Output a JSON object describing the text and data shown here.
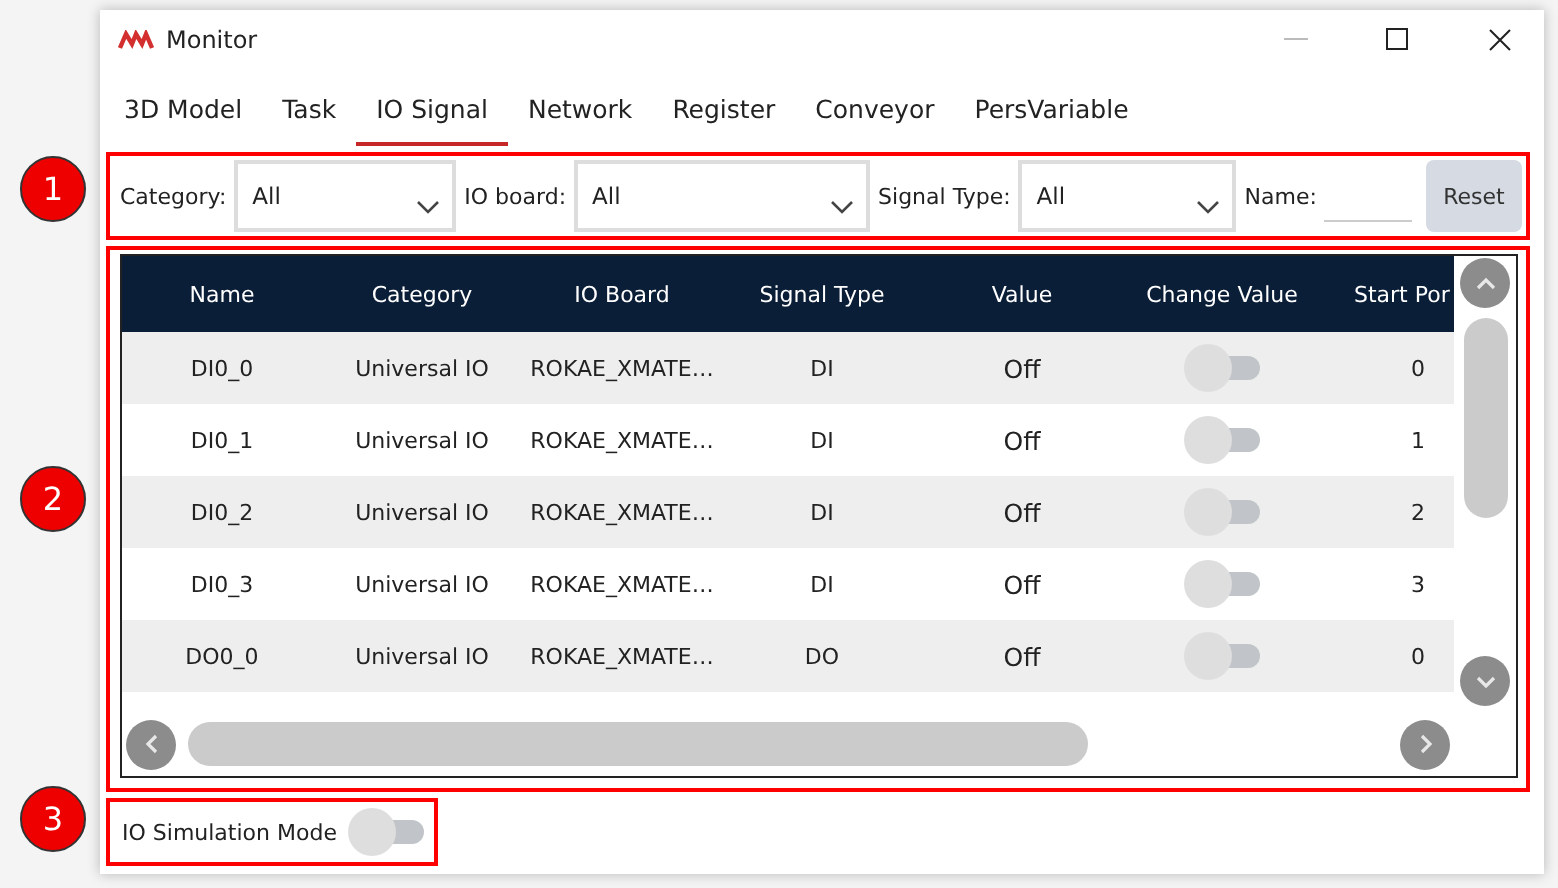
{
  "window": {
    "title": "Monitor"
  },
  "tabs": [
    {
      "label": "3D Model",
      "selected": false
    },
    {
      "label": "Task",
      "selected": false
    },
    {
      "label": "IO Signal",
      "selected": true
    },
    {
      "label": "Network",
      "selected": false
    },
    {
      "label": "Register",
      "selected": false
    },
    {
      "label": "Conveyor",
      "selected": false
    },
    {
      "label": "PersVariable",
      "selected": false
    }
  ],
  "filters": {
    "category": {
      "label": "Category:",
      "value": "All"
    },
    "io_board": {
      "label": "IO board:",
      "value": "All"
    },
    "signal_type": {
      "label": "Signal Type:",
      "value": "All"
    },
    "name": {
      "label": "Name:"
    },
    "reset_button": "Reset"
  },
  "table": {
    "columns": [
      "Name",
      "Category",
      "IO Board",
      "Signal Type",
      "Value",
      "Change Value",
      "Start Por"
    ],
    "rows": [
      {
        "name": "DI0_0",
        "category": "Universal IO",
        "io_board": "ROKAE_XMATE…",
        "signal_type": "DI",
        "value": "Off",
        "on": false,
        "start_port": "0"
      },
      {
        "name": "DI0_1",
        "category": "Universal IO",
        "io_board": "ROKAE_XMATE…",
        "signal_type": "DI",
        "value": "Off",
        "on": false,
        "start_port": "1"
      },
      {
        "name": "DI0_2",
        "category": "Universal IO",
        "io_board": "ROKAE_XMATE…",
        "signal_type": "DI",
        "value": "Off",
        "on": false,
        "start_port": "2"
      },
      {
        "name": "DI0_3",
        "category": "Universal IO",
        "io_board": "ROKAE_XMATE…",
        "signal_type": "DI",
        "value": "Off",
        "on": false,
        "start_port": "3"
      },
      {
        "name": "DO0_0",
        "category": "Universal IO",
        "io_board": "ROKAE_XMATE…",
        "signal_type": "DO",
        "value": "Off",
        "on": false,
        "start_port": "0"
      }
    ]
  },
  "simulation": {
    "label": "IO Simulation Mode",
    "on": false
  },
  "callouts": [
    "1",
    "2",
    "3"
  ]
}
